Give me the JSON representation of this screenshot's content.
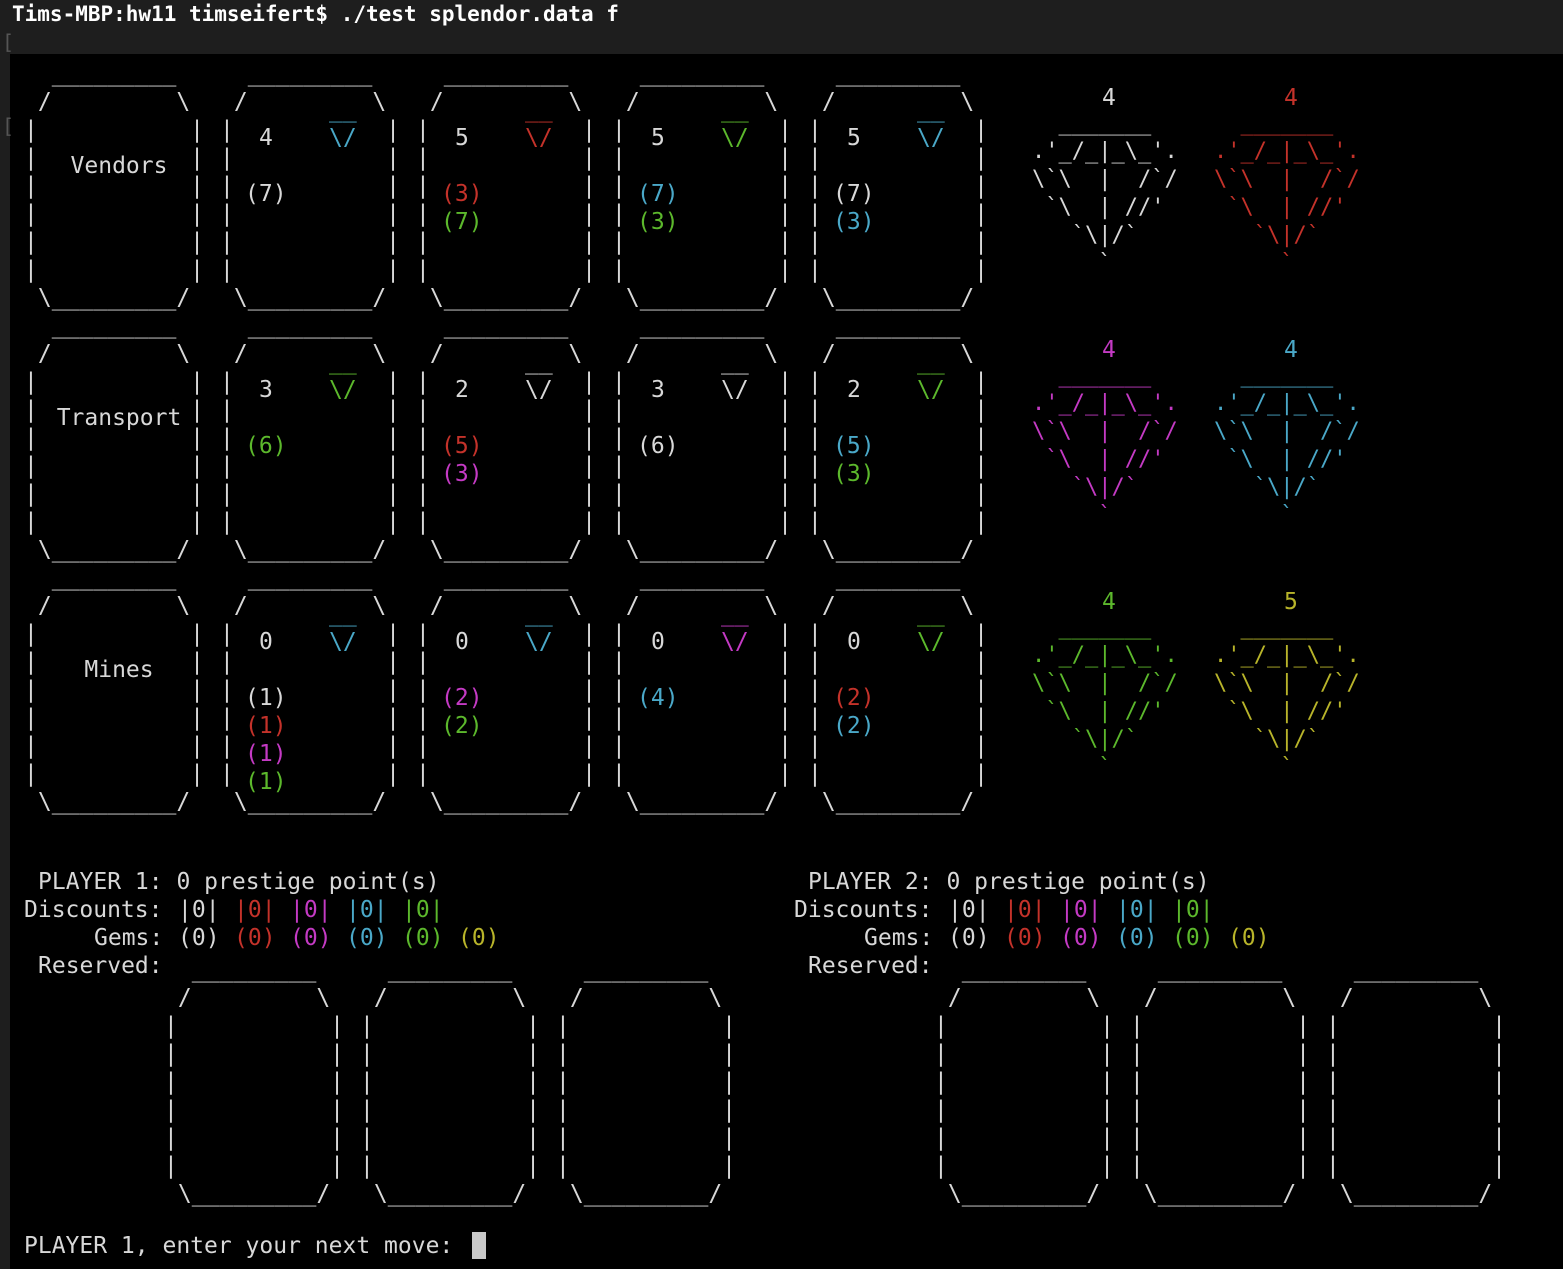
{
  "colors": {
    "white": "#d8d8d8",
    "red": "#c4322a",
    "magenta": "#c43ac4",
    "cyan": "#4aa8c8",
    "green": "#5cb82c",
    "yellow": "#b8b42a"
  },
  "terminal": {
    "command_line": "Tims-MBP:hw11 timseifert$ ./test splendor.data f",
    "input_prompt": "PLAYER 1, enter your next move: "
  },
  "rows": [
    {
      "label": "Vendors",
      "cards": [
        {
          "points": "4",
          "gem": "cyan",
          "costs": [
            [
              "(7)",
              "white"
            ]
          ]
        },
        {
          "points": "5",
          "gem": "red",
          "costs": [
            [
              "(3)",
              "red"
            ],
            [
              "(7)",
              "green"
            ]
          ]
        },
        {
          "points": "5",
          "gem": "green",
          "costs": [
            [
              "(7)",
              "cyan"
            ],
            [
              "(3)",
              "green"
            ]
          ]
        },
        {
          "points": "5",
          "gem": "cyan",
          "costs": [
            [
              "(7)",
              "white"
            ],
            [
              "(3)",
              "cyan"
            ]
          ]
        }
      ]
    },
    {
      "label": "Transport",
      "cards": [
        {
          "points": "3",
          "gem": "green",
          "costs": [
            [
              "(6)",
              "green"
            ]
          ]
        },
        {
          "points": "2",
          "gem": "white",
          "costs": [
            [
              "(5)",
              "red"
            ],
            [
              "(3)",
              "magenta"
            ]
          ]
        },
        {
          "points": "3",
          "gem": "white",
          "costs": [
            [
              "(6)",
              "white"
            ]
          ]
        },
        {
          "points": "2",
          "gem": "green",
          "costs": [
            [
              "(5)",
              "cyan"
            ],
            [
              "(3)",
              "green"
            ]
          ]
        }
      ]
    },
    {
      "label": "Mines",
      "cards": [
        {
          "points": "0",
          "gem": "cyan",
          "costs": [
            [
              "(1)",
              "white"
            ],
            [
              "(1)",
              "red"
            ],
            [
              "(1)",
              "magenta"
            ],
            [
              "(1)",
              "green"
            ]
          ]
        },
        {
          "points": "0",
          "gem": "cyan",
          "costs": [
            [
              "(2)",
              "magenta"
            ],
            [
              "(2)",
              "green"
            ]
          ]
        },
        {
          "points": "0",
          "gem": "magenta",
          "costs": [
            [
              "(4)",
              "cyan"
            ]
          ]
        },
        {
          "points": "0",
          "gem": "green",
          "costs": [
            [
              "(2)",
              "red"
            ],
            [
              "(2)",
              "cyan"
            ]
          ]
        }
      ]
    }
  ],
  "gem_bank": [
    [
      {
        "count": "4",
        "color": "white"
      },
      {
        "count": "4",
        "color": "red"
      }
    ],
    [
      {
        "count": "4",
        "color": "magenta"
      },
      {
        "count": "4",
        "color": "cyan"
      }
    ],
    [
      {
        "count": "4",
        "color": "green"
      },
      {
        "count": "5",
        "color": "yellow"
      }
    ]
  ],
  "players": [
    {
      "title": "PLAYER 1: 0 prestige point(s)",
      "discounts_label": "Discounts:",
      "discounts": [
        [
          "|0|",
          "white"
        ],
        [
          "|0|",
          "red"
        ],
        [
          "|0|",
          "magenta"
        ],
        [
          "|0|",
          "cyan"
        ],
        [
          "|0|",
          "green"
        ]
      ],
      "gems_label": "Gems:",
      "gems": [
        [
          "(0)",
          "white"
        ],
        [
          "(0)",
          "red"
        ],
        [
          "(0)",
          "magenta"
        ],
        [
          "(0)",
          "cyan"
        ],
        [
          "(0)",
          "green"
        ],
        [
          "(0)",
          "yellow"
        ]
      ],
      "reserved_label": "Reserved:"
    },
    {
      "title": "PLAYER 2: 0 prestige point(s)",
      "discounts_label": "Discounts:",
      "discounts": [
        [
          "|0|",
          "white"
        ],
        [
          "|0|",
          "red"
        ],
        [
          "|0|",
          "magenta"
        ],
        [
          "|0|",
          "cyan"
        ],
        [
          "|0|",
          "green"
        ]
      ],
      "gems_label": "Gems:",
      "gems": [
        [
          "(0)",
          "white"
        ],
        [
          "(0)",
          "red"
        ],
        [
          "(0)",
          "magenta"
        ],
        [
          "(0)",
          "cyan"
        ],
        [
          "(0)",
          "green"
        ],
        [
          "(0)",
          "yellow"
        ]
      ],
      "reserved_label": "Reserved:"
    }
  ]
}
